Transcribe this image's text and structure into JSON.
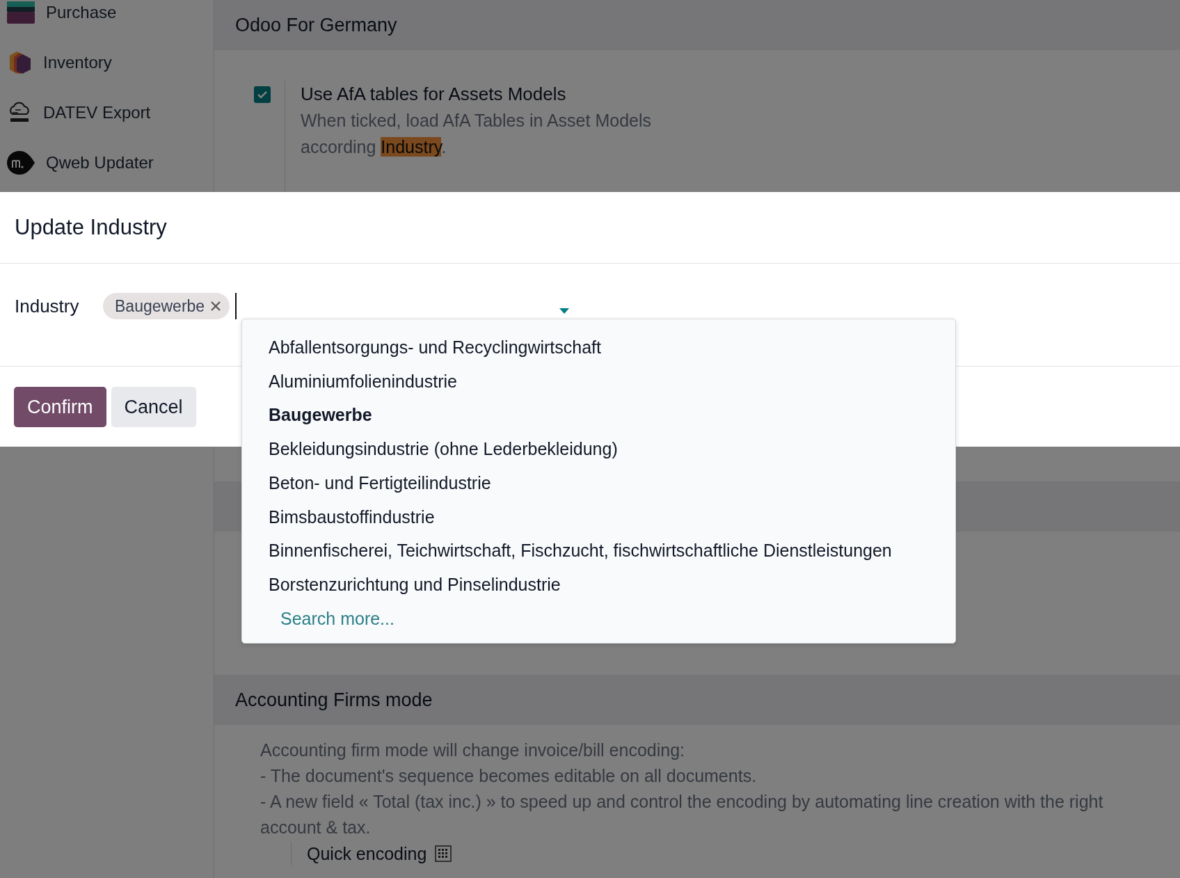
{
  "sidebar": {
    "items": [
      {
        "label": "Purchase",
        "kind": "purchase"
      },
      {
        "label": "Inventory",
        "kind": "inventory"
      },
      {
        "label": "DATEV Export",
        "kind": "datev"
      },
      {
        "label": "Qweb Updater",
        "kind": "qweb"
      }
    ]
  },
  "sections": [
    {
      "title": "Odoo For Germany",
      "settings": [
        {
          "title": "Use AfA tables for Assets Models",
          "checked": true,
          "description_before": "When ticked, load AfA Tables in Asset Models according ",
          "highlight": "Industry",
          "description_after": "."
        }
      ]
    },
    {
      "title": "Accounting Firms mode",
      "lines": [
        "Accounting firm mode will change invoice/bill encoding:",
        "- The document's sequence becomes editable on all documents.",
        "- A new field « Total (tax inc.) » to speed up and control the encoding by automating line creation with the right account & tax."
      ],
      "sub_setting": "Quick encoding"
    }
  ],
  "dialog": {
    "title": "Update Industry",
    "field_label": "Industry",
    "tags": [
      {
        "label": "Baugewerbe"
      }
    ],
    "options": [
      {
        "label": "Abfallentsorgungs- und Recyclingwirtschaft",
        "selected": false
      },
      {
        "label": "Aluminiumfolienindustrie",
        "selected": false
      },
      {
        "label": "Baugewerbe",
        "selected": true
      },
      {
        "label": "Bekleidungsindustrie (ohne Lederbekleidung)",
        "selected": false
      },
      {
        "label": "Beton- und Fertigteilindustrie",
        "selected": false
      },
      {
        "label": "Bimsbaustoffindustrie",
        "selected": false
      },
      {
        "label": "Binnenfischerei, Teichwirtschaft, Fischzucht, fischwirtschaftliche Dienstleistungen",
        "selected": false
      },
      {
        "label": "Borstenzurichtung und Pinselindustrie",
        "selected": false
      }
    ],
    "search_more": "Search more...",
    "buttons": [
      {
        "label": "Confirm",
        "kind": "primary"
      },
      {
        "label": "Cancel",
        "kind": "secondary"
      }
    ]
  }
}
